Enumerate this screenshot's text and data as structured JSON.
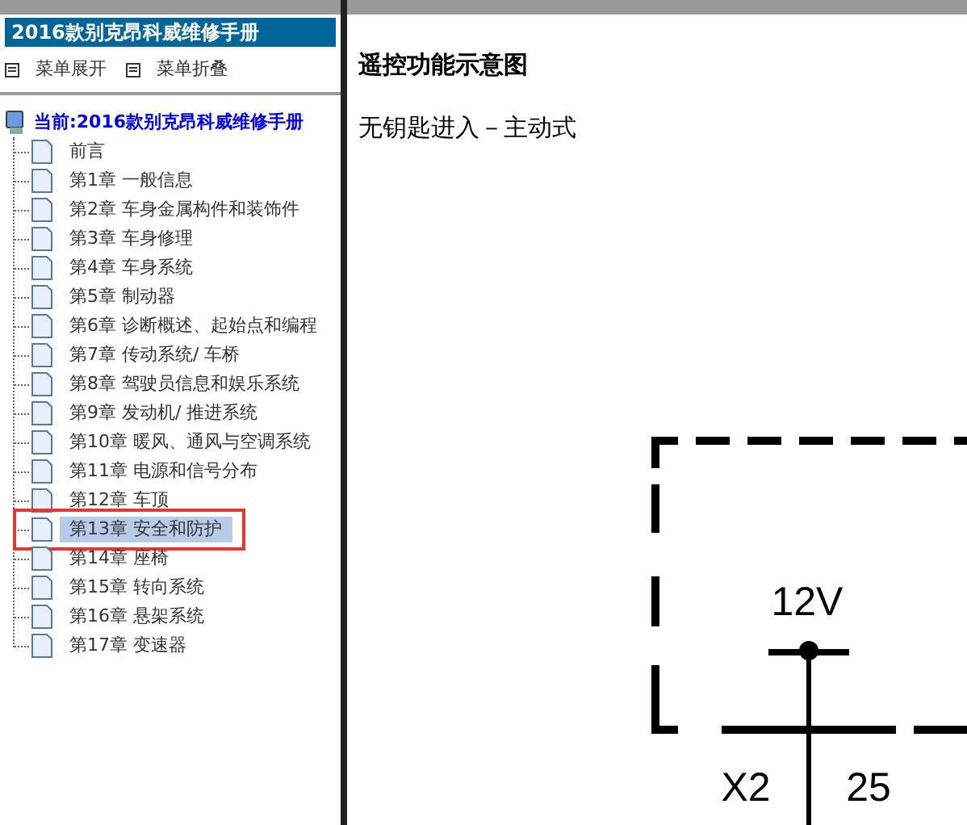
{
  "sidebar": {
    "title": "2016款别克昂科威维修手册",
    "menu_buttons": [
      {
        "label": "菜单展开"
      },
      {
        "label": "菜单折叠"
      }
    ],
    "tree": {
      "label": "当前:2016款别克昂科威维修手册",
      "children": [
        {
          "label": "前言",
          "selected": false
        },
        {
          "label": "第1章 一般信息",
          "selected": false
        },
        {
          "label": "第2章 车身金属构件和装饰件",
          "selected": false
        },
        {
          "label": "第3章 车身修理",
          "selected": false
        },
        {
          "label": "第4章 车身系统",
          "selected": false
        },
        {
          "label": "第5章 制动器",
          "selected": false
        },
        {
          "label": "第6章 诊断概述、起始点和编程",
          "selected": false
        },
        {
          "label": "第7章 传动系统/ 车桥",
          "selected": false
        },
        {
          "label": "第8章 驾驶员信息和娱乐系统",
          "selected": false
        },
        {
          "label": "第9章 发动机/ 推进系统",
          "selected": false
        },
        {
          "label": "第10章 暖风、通风与空调系统",
          "selected": false
        },
        {
          "label": "第11章 电源和信号分布",
          "selected": false
        },
        {
          "label": "第12章 车顶",
          "selected": false
        },
        {
          "label": "第13章 安全和防护",
          "selected": true
        },
        {
          "label": "第14章 座椅",
          "selected": false
        },
        {
          "label": "第15章 转向系统",
          "selected": false
        },
        {
          "label": "第16章 悬架系统",
          "selected": false
        },
        {
          "label": "第17章 变速器",
          "selected": false
        }
      ]
    }
  },
  "content": {
    "heading": "遥控功能示意图",
    "subtitle": "无钥匙进入－主动式",
    "diagram_labels": [
      "12V",
      "X2",
      "25"
    ]
  }
}
